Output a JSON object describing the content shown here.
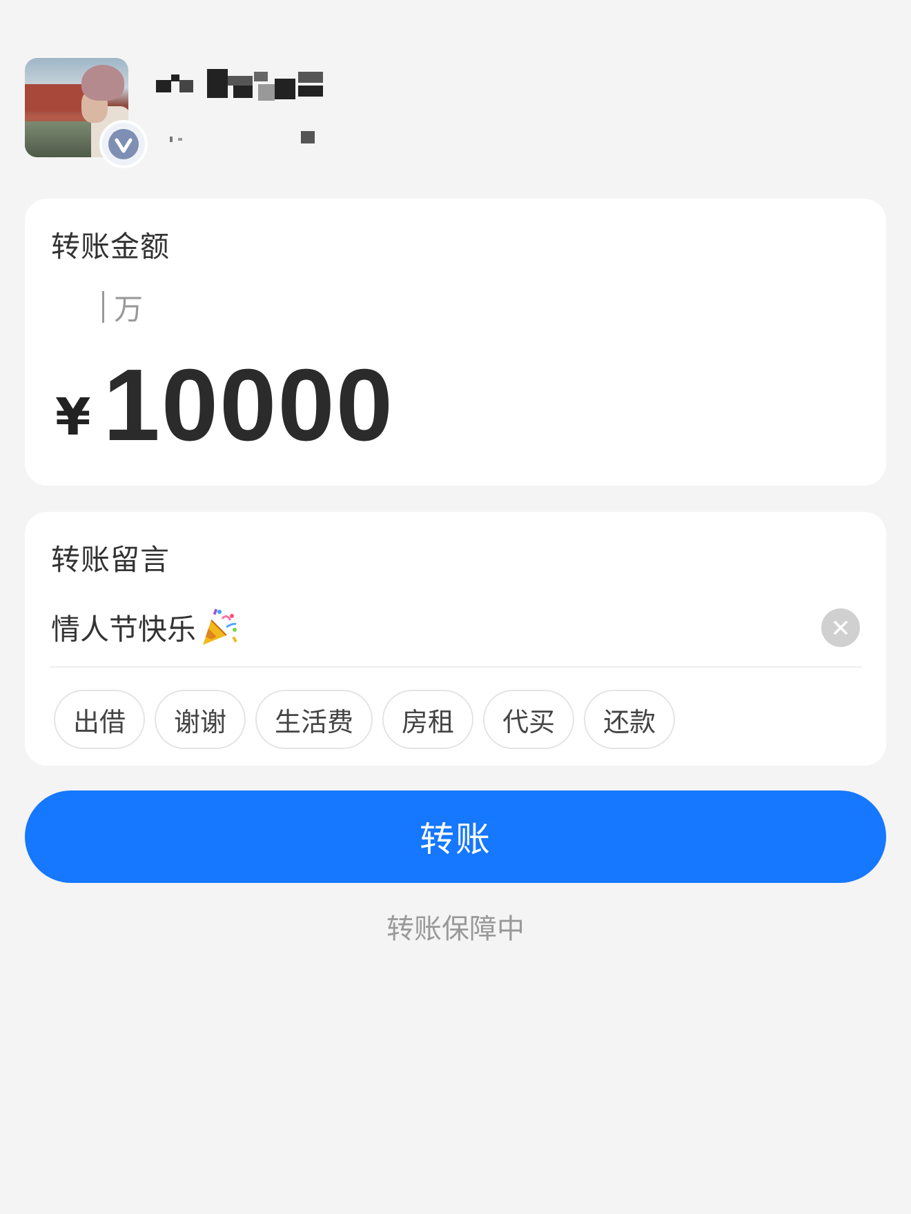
{
  "header": {
    "avatar_alt": "user avatar",
    "verified_icon": "verified-v-badge-icon"
  },
  "amount_card": {
    "title": "转账金额",
    "unit_hint": "万",
    "currency_symbol": "¥",
    "amount": "10000"
  },
  "note_card": {
    "title": "转账留言",
    "note_value": "情人节快乐",
    "note_emoji_icon": "party-popper-icon",
    "clear_icon": "close-icon",
    "suggestions": [
      "出借",
      "谢谢",
      "生活费",
      "房租",
      "代买",
      "还款"
    ]
  },
  "actions": {
    "transfer_label": "转账",
    "guarantee_text": "转账保障中"
  },
  "colors": {
    "primary": "#1677ff",
    "background": "#f4f4f4",
    "card": "#ffffff"
  }
}
